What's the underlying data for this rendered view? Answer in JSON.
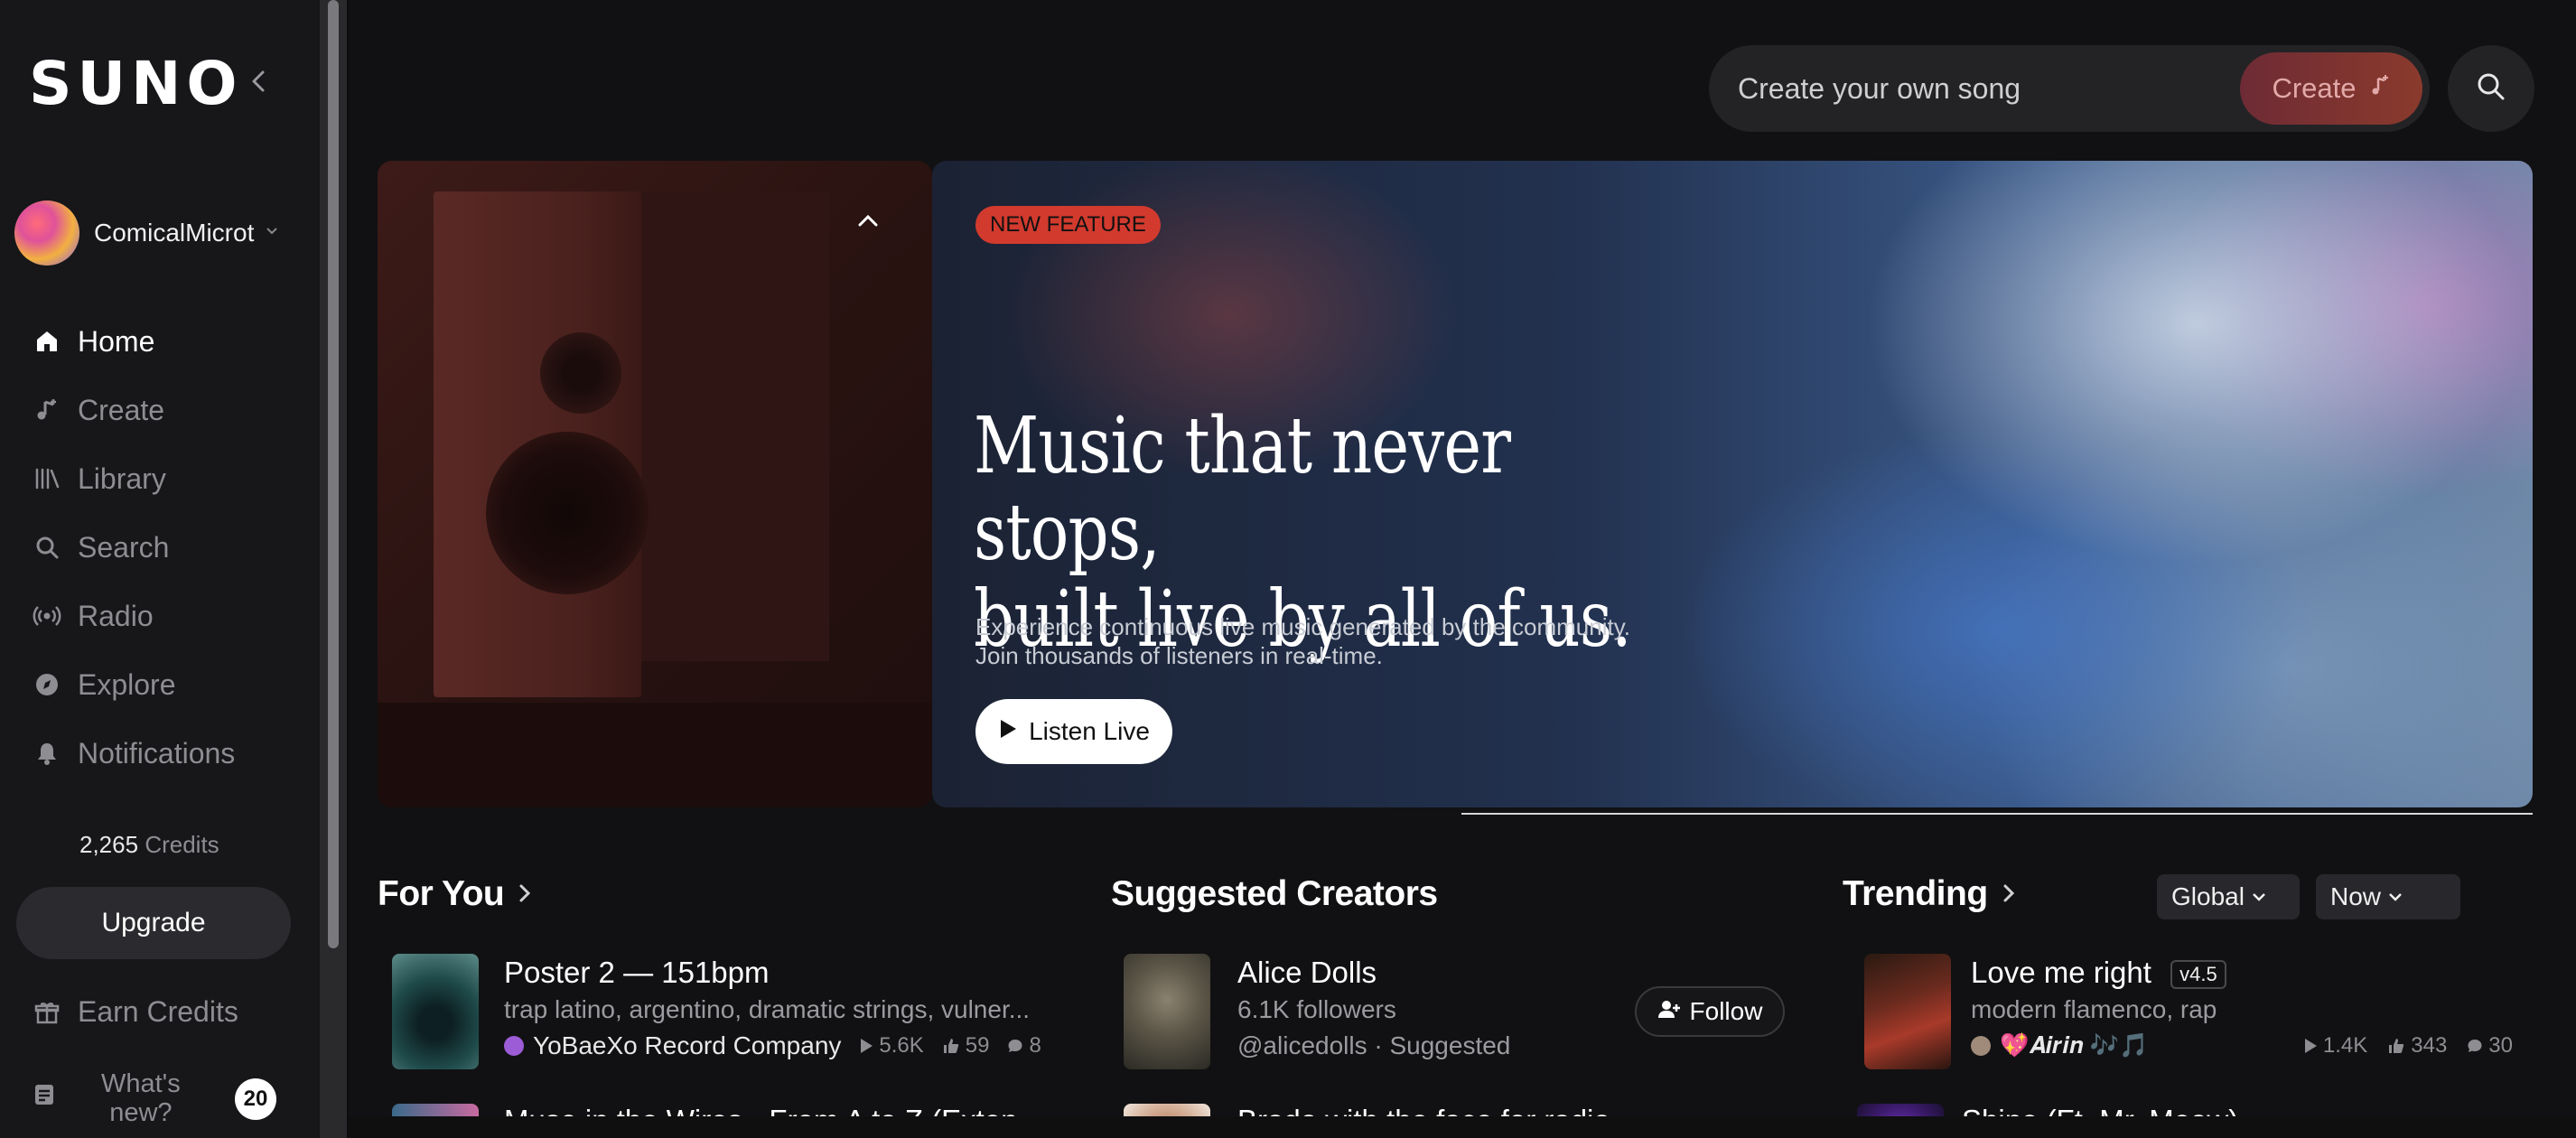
{
  "sidebar": {
    "logo": "SUNO",
    "user": {
      "name": "ComicalMicrot"
    },
    "nav": [
      {
        "label": "Home",
        "icon": "home-icon",
        "active": true
      },
      {
        "label": "Create",
        "icon": "music-note-icon"
      },
      {
        "label": "Library",
        "icon": "library-icon"
      },
      {
        "label": "Search",
        "icon": "search-icon"
      },
      {
        "label": "Radio",
        "icon": "radio-icon"
      },
      {
        "label": "Explore",
        "icon": "compass-icon"
      },
      {
        "label": "Notifications",
        "icon": "bell-icon"
      }
    ],
    "credits_value": "2,265",
    "credits_label": "Credits",
    "upgrade_label": "Upgrade",
    "earn_label": "Earn Credits",
    "whatsnew_line1": "What's",
    "whatsnew_line2": "new?",
    "whatsnew_count": "20"
  },
  "topbar": {
    "create_placeholder": "Create your own song",
    "create_button": "Create"
  },
  "hero": {
    "badge": "NEW FEATURE",
    "title_line1": "Music that never stops,",
    "title_line2": "built live by all of us.",
    "sub_line1": "Experience continuous live music generated by the community.",
    "sub_line2": "Join thousands of listeners in real-time.",
    "button": "Listen Live",
    "progress": 0.56
  },
  "for_you": {
    "title": "For You",
    "items": [
      {
        "title": "Poster 2 — 151bpm",
        "tags": "trap latino, argentino, dramatic strings, vulner...",
        "artist": "YoBaeXo Record Company",
        "plays": "5.6K",
        "likes": "59",
        "comments": "8"
      },
      {
        "title": "Muse in the Wires - From A to Z (Exten..."
      }
    ]
  },
  "creators": {
    "title": "Suggested Creators",
    "items": [
      {
        "name": "Alice Dolls",
        "followers": "6.1K followers",
        "handle": "@alicedolls · Suggested",
        "follow_label": "Follow"
      },
      {
        "name": "Brado with the face for radio"
      }
    ]
  },
  "trending": {
    "title": "Trending",
    "region": "Global",
    "period": "Now",
    "items": [
      {
        "title": "Love me right",
        "version": "v4.5",
        "tags": "modern flamenco, rap",
        "artist": "💖𝑨𝒊𝒓𝒊𝒏 🎶🎵",
        "plays": "1.4K",
        "likes": "343",
        "comments": "30"
      },
      {
        "title": "Shine (Ft. Mr. Meow)"
      }
    ]
  },
  "colors": {
    "accent_red": "#d23a2e",
    "background": "#111113",
    "sidebar": "#17171a"
  }
}
